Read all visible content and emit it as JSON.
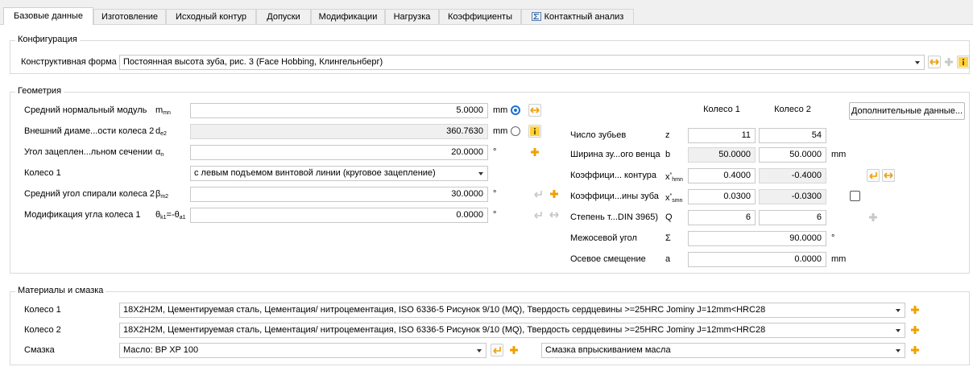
{
  "tabs": [
    {
      "label": "Базовые данные",
      "active": true
    },
    {
      "label": "Изготовление"
    },
    {
      "label": "Исходный контур"
    },
    {
      "label": "Допуски"
    },
    {
      "label": "Модификации"
    },
    {
      "label": "Нагрузка"
    },
    {
      "label": "Коэффициенты"
    },
    {
      "label": "Контактный анализ"
    }
  ],
  "config": {
    "title": "Конфигурация",
    "form_label": "Конструктивная форма",
    "form_value": "Постоянная высота зуба, рис. 3 (Face Hobbing, Клингельнберг)"
  },
  "geometry": {
    "title": "Геометрия",
    "module": {
      "label": "Средний нормальный модуль",
      "sym": "m",
      "sub": "mn",
      "value": "5.0000",
      "unit": "mm"
    },
    "diameter": {
      "label": "Внешний диаме...ости колеса 2",
      "sym": "d",
      "sub": "e2",
      "value": "360.7630",
      "unit": "mm"
    },
    "pressure_angle": {
      "label": "Угол зацеплен...льном сечении",
      "sym": "α",
      "sub": "n",
      "value": "20.0000",
      "unit": "°"
    },
    "wheel1": {
      "label": "Колесо 1",
      "value": "с левым подъемом винтовой линии (круговое зацепление)"
    },
    "spiral_angle": {
      "label": "Средний угол спирали колеса 2",
      "sym": "β",
      "sub": "m2",
      "value": "30.0000",
      "unit": "°"
    },
    "angle_mod": {
      "label": "Модификация угла колеса 1",
      "sym": "θ",
      "sub": "k1",
      "sym2": "=-θ",
      "sub2": "a1",
      "value": "0.0000",
      "unit": "°"
    },
    "col1": "Колесо 1",
    "col2": "Колесо 2",
    "extra_button": "Дополнительные данные...",
    "rows": [
      {
        "label": "Число зубьев",
        "sym": "z",
        "sub": "",
        "v1": "11",
        "v2": "54",
        "unit": ""
      },
      {
        "label": "Ширина зу...ого венца",
        "sym": "b",
        "sub": "",
        "v1": "50.0000",
        "v2": "50.0000",
        "unit": "mm"
      },
      {
        "label": "Коэффици... контура",
        "sym": "x",
        "sup": "*",
        "sub": "hmn",
        "v1": "0.4000",
        "v2": "-0.4000",
        "unit": ""
      },
      {
        "label": "Коэффици...ины зуба",
        "sym": "x",
        "sup": "*",
        "sub": "smn",
        "v1": "0.0300",
        "v2": "-0.0300",
        "unit": ""
      },
      {
        "label": "Степень т...DIN 3965)",
        "sym": "Q",
        "sub": "",
        "v1": "6",
        "v2": "6",
        "unit": ""
      }
    ],
    "shaft_angle": {
      "label": "Межосевой угол",
      "sym": "Σ",
      "value": "90.0000",
      "unit": "°"
    },
    "offset": {
      "label": "Осевое смещение",
      "sym": "a",
      "value": "0.0000",
      "unit": "mm"
    }
  },
  "materials": {
    "title": "Материалы и смазка",
    "wheel1_label": "Колесо 1",
    "wheel1_value": "18Х2Н2М, Цементируемая сталь, Цементация/ нитроцементация, ISO 6336-5 Рисунок 9/10 (MQ), Твердость сердцевины >=25HRC Jominy J=12mm<HRC28",
    "wheel2_label": "Колесо 2",
    "wheel2_value": "18Х2Н2М, Цементируемая сталь, Цементация/ нитроцементация, ISO 6336-5 Рисунок 9/10 (MQ), Твердость сердцевины >=25HRC Jominy J=12mm<HRC28",
    "lube_label": "Смазка",
    "lube_value": "Масло: BP XP 100",
    "lube_method": "Смазка впрыскиванием масла"
  },
  "colors": {
    "accent": "#1f6fd0",
    "plus": "#f0a000",
    "arrow": "#f0a000"
  }
}
